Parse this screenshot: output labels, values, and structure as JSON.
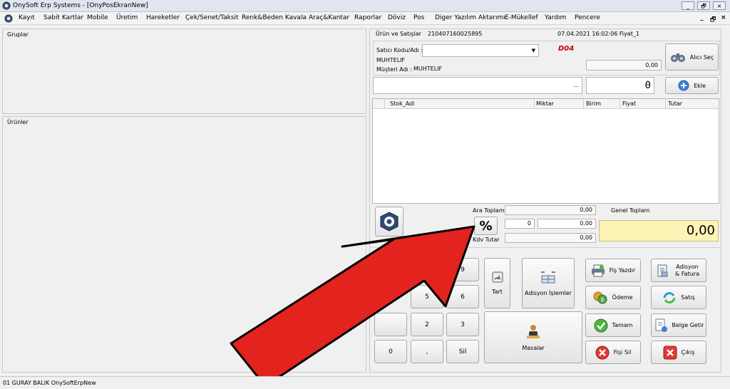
{
  "window": {
    "title": "OnySoft Erp Systems - [OnyPosEkranNew]",
    "min": "_",
    "restore": "🗗",
    "close": "×"
  },
  "menu": [
    "Kayıt",
    "Sabit Kartlar",
    "Mobile",
    "Üretim",
    "Hareketler",
    "Çek/Senet/Taksit",
    "Renk&Beden Kavala",
    "Araç&Kantar",
    "Raporlar",
    "Döviz",
    "Pos",
    "Diger Yazılım Aktarımı",
    "E-Mükellef",
    "Yardım",
    "Pencere"
  ],
  "menu_right": {
    "min": "_",
    "restore": "🗗",
    "close": "×"
  },
  "left": {
    "groups_label": "Gruplar",
    "products_label": "Ürünler"
  },
  "sales": {
    "header_label": "Ürün ve Satışlar",
    "doc_no": "210407160025895",
    "datetime": "07.04.2021 16:02:06 Fiyat_1",
    "seller_label": "Satıcı Kodu/Adı :",
    "seller_name": "MUHTELIF",
    "customer_label": "Müşteri Adı :",
    "customer_name": "MUHTELIF",
    "badge": "D04",
    "balance": "0,00",
    "customer_button": "Alıcı Seç",
    "product_field": "",
    "product_dots": "...",
    "qty": "0",
    "add_button": "Ekle"
  },
  "table": {
    "columns": [
      "Stok_Adi",
      "Miktar",
      "Birim",
      "Fiyat",
      "Tutar"
    ]
  },
  "totals": {
    "subtotal_label": "Ara Toplam",
    "subtotal": "0,00",
    "discount_pct": "0",
    "discount": "0,00",
    "percent_symbol": "%",
    "vat_label": "Kdv Tutar",
    "vat": "0,00",
    "grand_label": "Genel Toplam",
    "grand": "0,00"
  },
  "keypad": {
    "k9": "9",
    "k5": "5",
    "k6": "6",
    "k2": "2",
    "k3": "3",
    "k0": "0",
    "comma": ",",
    "delete": "Sil",
    "tare": "Tart",
    "table_ops": "Adisyon İşlemler",
    "tables": "Masalar"
  },
  "actions": {
    "print_receipt": "Fiş Yazdır",
    "bill_invoice": "Adisyon & Fatura",
    "payment": "Ödeme",
    "sale": "Satış",
    "ok": "Tamam",
    "get_doc": "Belge Getir",
    "delete_receipt": "Fişi Sil",
    "exit": "Çıkış"
  },
  "status": {
    "user": "01  GURAY BALIK  OnySoftErpNew"
  },
  "colors": {
    "arrow": "#e3231d",
    "badge": "#cc0000",
    "grand_bg": "#fdf3b5"
  }
}
